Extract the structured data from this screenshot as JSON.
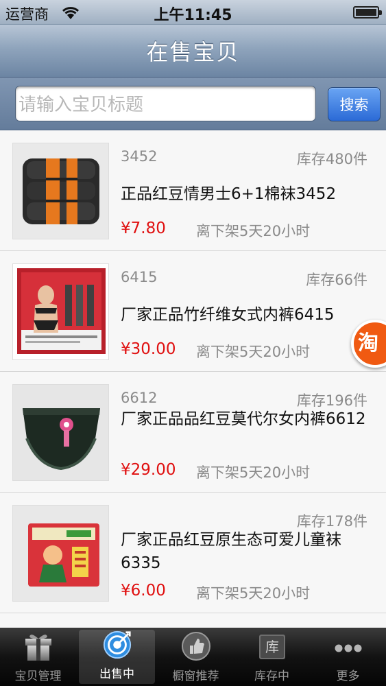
{
  "status": {
    "carrier": "运营商",
    "time": "上午11:45"
  },
  "nav": {
    "title": "在售宝贝"
  },
  "search": {
    "placeholder": "请输入宝贝标题",
    "button_label": "搜索"
  },
  "items": [
    {
      "code": "3452",
      "stock": "库存480件",
      "title": "正品红豆情男士6+1棉袜3452",
      "price": "¥7.80",
      "delist": "离下架5天20小时"
    },
    {
      "code": "6415",
      "stock": "库存66件",
      "title": "厂家正品竹纤维女式内裤6415",
      "price": "¥30.00",
      "delist": "离下架5天20小时"
    },
    {
      "code": "6612",
      "stock": "库存196件",
      "title": "厂家正品品红豆莫代尔女内裤6612",
      "price": "¥29.00",
      "delist": "离下架5天20小时"
    },
    {
      "code": "",
      "stock": "库存178件",
      "title": "厂家正品红豆原生态可爱儿童袜6335",
      "price": "¥6.00",
      "delist": "离下架5天20小时"
    }
  ],
  "float_badge": {
    "text": "淘"
  },
  "tabs": [
    {
      "label": "宝贝管理",
      "icon": "gift-icon"
    },
    {
      "label": "出售中",
      "icon": "target-icon",
      "active": true
    },
    {
      "label": "橱窗推荐",
      "icon": "thumbs-up-icon"
    },
    {
      "label": "库存中",
      "icon": "warehouse-icon"
    },
    {
      "label": "更多",
      "icon": "more-dots-icon"
    }
  ],
  "colors": {
    "price": "#e01010",
    "accent_blue": "#2b6ad6",
    "badge": "#f05a12"
  }
}
